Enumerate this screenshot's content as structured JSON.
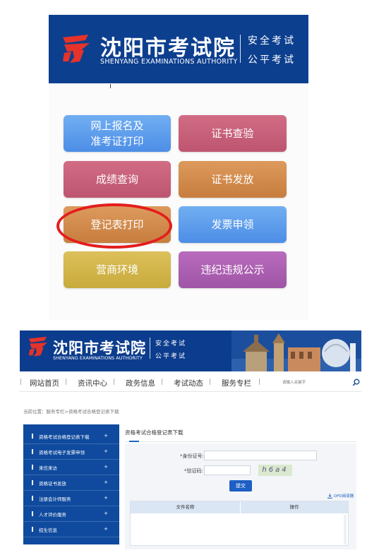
{
  "logo": {
    "title": "沈阳市考试院",
    "subtitle": "SHENYANG EXAMINATIONS AUTHORITY",
    "slogan_1": "安全考试",
    "slogan_2": "公平考试",
    "brand_color": "#0d3f8f"
  },
  "tiles": [
    {
      "line1": "网上报名及",
      "line2": "准考证打印",
      "color": "#5d9cec"
    },
    {
      "line1": "证书查验",
      "line2": "",
      "color": "#c9637c"
    },
    {
      "line1": "成绩查询",
      "line2": "",
      "color": "#c9637c"
    },
    {
      "line1": "证书发放",
      "line2": "",
      "color": "#d58c4f"
    },
    {
      "line1": "登记表打印",
      "line2": "",
      "color": "#d58c4f",
      "highlighted": true
    },
    {
      "line1": "发票申领",
      "line2": "",
      "color": "#5d9cec"
    },
    {
      "line1": "营商环境",
      "line2": "",
      "color": "#d2b64b"
    },
    {
      "line1": "违纪违规公示",
      "line2": "",
      "color": "#ac5fb2"
    }
  ],
  "highlight_color": "#e41d1d",
  "site": {
    "title": "沈阳市考试院",
    "subtitle": "SHENYANG EXAMINATIONS AUTHORITY",
    "slogan_1": "安全考试",
    "slogan_2": "公平考试"
  },
  "nav": {
    "items": [
      "网站首页",
      "资讯中心",
      "政务信息",
      "考试动态",
      "服务专栏"
    ],
    "search_placeholder": "请输入关键字",
    "search_icon": "search-icon"
  },
  "breadcrumb": "当前位置：服务专栏>资格考试合格登记表下载",
  "sidebar": {
    "items": [
      "资格考试合格登记表下载",
      "资格考试电子发票申领",
      "来信来访",
      "资格证书发放",
      "注册会计师服务",
      "人才评价服务",
      "招生信息"
    ],
    "plus": "+"
  },
  "main": {
    "title": "资格考试合格登记表下载",
    "id_label": "*身份证号:",
    "code_label": "*验证码:",
    "captcha_text": "h6a4",
    "submit_label": "提交",
    "ocr_link": "OFD阅读器",
    "table_headers": [
      "文件名称",
      "操作"
    ]
  }
}
